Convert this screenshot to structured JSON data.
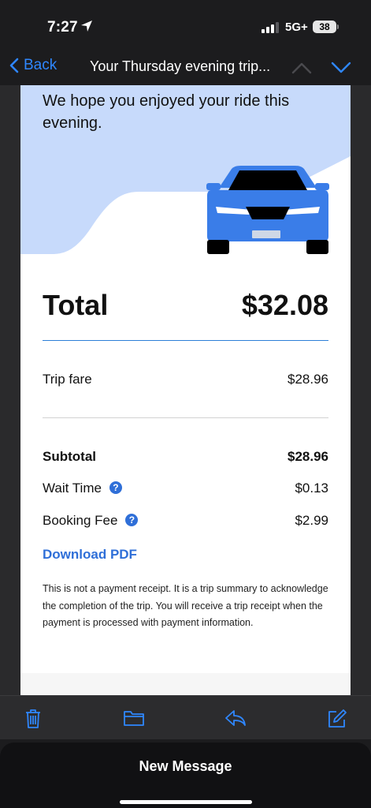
{
  "status_bar": {
    "time": "7:27",
    "network": "5G+",
    "battery": "38"
  },
  "nav": {
    "back_label": "Back",
    "title": "Your Thursday evening trip..."
  },
  "email": {
    "hero_text": "We hope you enjoyed your ride this evening.",
    "total_label": "Total",
    "total_value": "$32.08",
    "trip_fare_label": "Trip fare",
    "trip_fare_value": "$28.96",
    "subtotal_label": "Subtotal",
    "subtotal_value": "$28.96",
    "wait_time_label": "Wait Time",
    "wait_time_value": "$0.13",
    "booking_fee_label": "Booking Fee",
    "booking_fee_value": "$2.99",
    "download_label": "Download PDF",
    "disclaimer": "This is not a payment receipt. It is a trip summary to acknowledge the completion of the trip. You will receive a trip receipt when the payment is processed with payment information."
  },
  "toolbar": {
    "icons": [
      "trash-icon",
      "folder-icon",
      "reply-icon",
      "compose-icon"
    ]
  },
  "new_message": {
    "label": "New Message"
  },
  "colors": {
    "ios_blue": "#2f87ff",
    "hero_blue": "#c7dafb",
    "car_blue": "#3a7de8",
    "link_blue": "#2f6fd8"
  }
}
